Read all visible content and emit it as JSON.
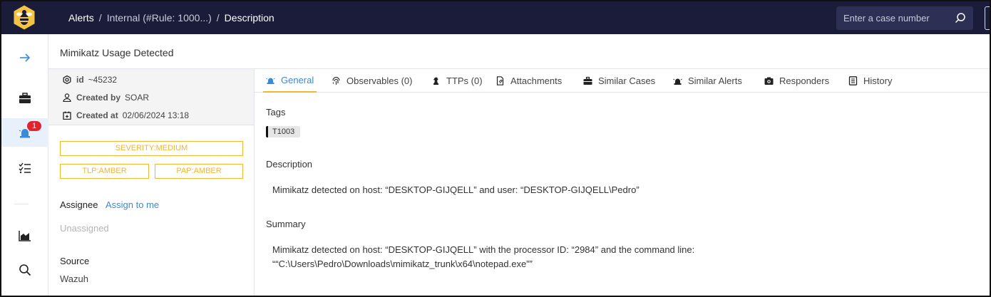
{
  "topbar": {
    "breadcrumb": [
      "Alerts",
      "Internal (#Rule: 1000...)",
      "Description"
    ],
    "breadcrumb_sep": "/",
    "search_placeholder": "Enter a case number"
  },
  "leftnav": {
    "items": [
      "arrow-right-icon",
      "briefcase-icon",
      "alert-siren-icon",
      "task-list-icon",
      "dashboard-chart-icon",
      "search-icon"
    ],
    "alerts_badge": "1"
  },
  "case": {
    "title": "Mimikatz Usage Detected"
  },
  "meta": {
    "id_label": "id",
    "id_value": "~45232",
    "created_by_label": "Created by",
    "created_by_value": "SOAR",
    "created_at_label": "Created at",
    "created_at_value": "02/06/2024 13:18"
  },
  "pills": {
    "severity": "SEVERITY:MEDIUM",
    "tlp": "TLP:AMBER",
    "pap": "PAP:AMBER",
    "color": "#f2b631"
  },
  "assignee": {
    "label": "Assignee",
    "action": "Assign to me",
    "value": "Unassigned"
  },
  "source": {
    "label": "Source",
    "value": "Wazuh"
  },
  "tabs": [
    {
      "label": "General",
      "icon": "siren-icon"
    },
    {
      "label": "Observables (0)",
      "icon": "fingerprint-icon"
    },
    {
      "label": "TTPs (0)",
      "icon": "chess-knight-icon"
    },
    {
      "label": "Attachments",
      "icon": "file-icon"
    },
    {
      "label": "Similar Cases",
      "icon": "briefcase-icon"
    },
    {
      "label": "Similar Alerts",
      "icon": "siren-icon"
    },
    {
      "label": "Responders",
      "icon": "camera-icon"
    },
    {
      "label": "History",
      "icon": "book-icon"
    }
  ],
  "general": {
    "tags_label": "Tags",
    "tags": [
      "T1003"
    ],
    "description_label": "Description",
    "description": "Mimikatz detected on host: “DESKTOP-GIJQELL” and user: “DESKTOP-GIJQELL\\Pedro”",
    "summary_label": "Summary",
    "summary_line1": "Mimikatz detected on host: “DESKTOP-GIJQELL” with the processor ID: “2984” and the command line:",
    "summary_line2": "““C:\\Users\\Pedro\\Downloads\\mimikatz_trunk\\x64\\notepad.exe””"
  },
  "colors": {
    "topbar": "#1b1c3a",
    "accent_link": "#3a8ad8",
    "badge": "#e0242e"
  }
}
